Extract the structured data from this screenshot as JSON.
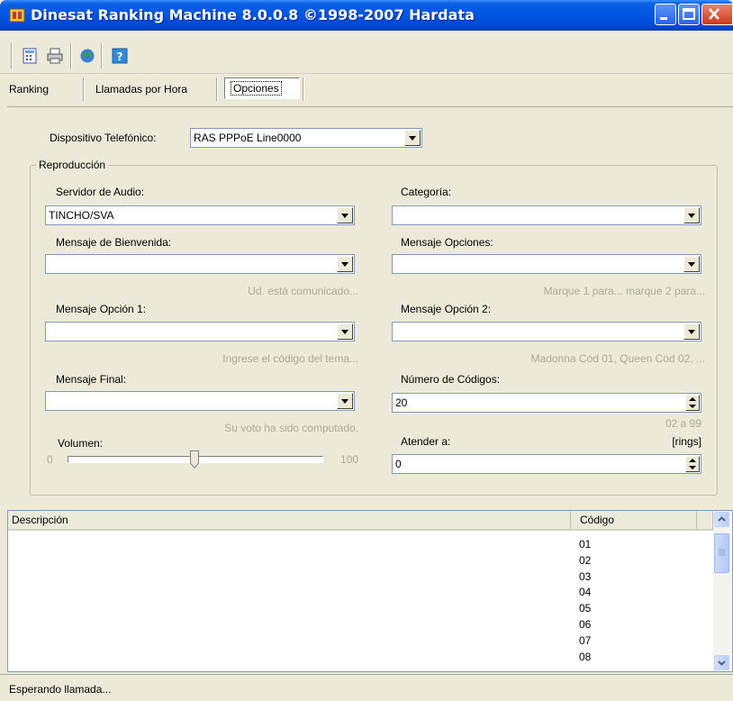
{
  "window": {
    "title": "Dinesat Ranking Machine 8.0.0.8 ©1998-2007 Hardata",
    "controls": [
      "minimize",
      "maximize",
      "close"
    ]
  },
  "toolbar": {
    "tools": [
      {
        "icon": "calculator-icon"
      },
      {
        "icon": "printer-icon"
      },
      {
        "icon": "globe-icon"
      },
      {
        "icon": "help-icon"
      }
    ]
  },
  "tabs": [
    {
      "label": "Ranking",
      "active": false
    },
    {
      "label": "Llamadas por Hora",
      "active": false
    },
    {
      "label": "Opciones",
      "active": true
    }
  ],
  "options": {
    "dispositivo_label": "Dispositivo Telefónico:",
    "dispositivo_value": "RAS PPPoE Line0000",
    "group_title": "Reproducción",
    "servidor_label": "Servidor de Audio:",
    "servidor_value": "TINCHO/SVA",
    "categoria_label": "Categoría:",
    "categoria_value": "",
    "bienvenida_label": "Mensaje de Bienvenida:",
    "bienvenida_value": "",
    "bienvenida_hint": "Ud. está comunicado...",
    "opciones_label": "Mensaje Opciones:",
    "opciones_value": "",
    "opciones_hint": "Marque 1 para... marque 2 para...",
    "opcion1_label": "Mensaje  Opción 1:",
    "opcion1_value": "",
    "opcion1_hint": "Ingrese el código del tema...",
    "opcion2_label": "Mensaje Opción 2:",
    "opcion2_value": "",
    "opcion2_hint": "Madonna Cód 01, Queen Cód 02, ...",
    "final_label": "Mensaje Final:",
    "final_value": "",
    "final_hint": "Su voto ha sido computado.",
    "num_codigos_label": "Número de Códigos:",
    "num_codigos_value": "20",
    "num_codigos_range": "02 a 99",
    "volumen_label": "Volumen:",
    "volumen_min": "0",
    "volumen_max": "100",
    "volumen_level": 0.5,
    "atender_label": "Atender a:",
    "atender_unit": "[rings]",
    "atender_value": "0"
  },
  "list": {
    "col_descripcion": "Descripción",
    "col_codigo": "Código",
    "codes": [
      "01",
      "02",
      "03",
      "04",
      "05",
      "06",
      "07",
      "08"
    ]
  },
  "status": {
    "text": "Esperando llamada..."
  },
  "colors": {
    "titlebar": "#0055e5",
    "window_bg": "#ece9d8",
    "hint_text": "#aca899"
  }
}
